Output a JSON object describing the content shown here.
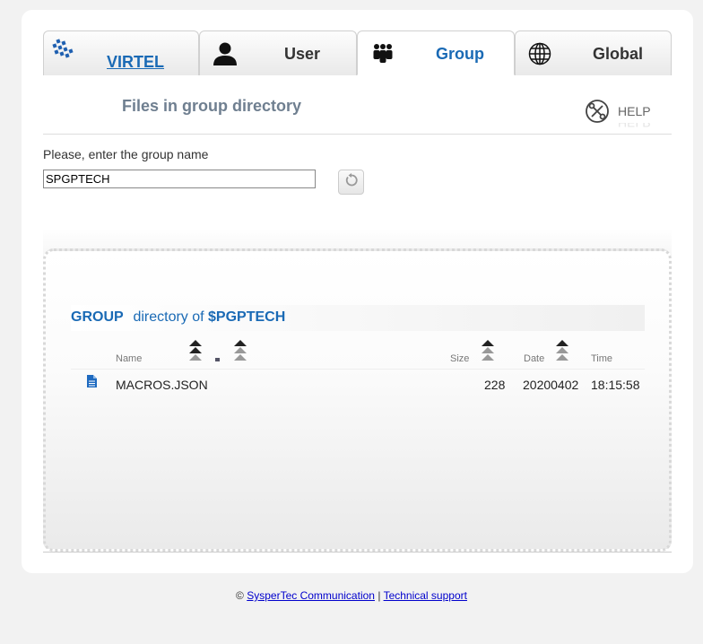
{
  "tabs": [
    {
      "label": "VIRTEL",
      "icon": "virtel-logo-icon"
    },
    {
      "label": "User",
      "icon": "user-icon"
    },
    {
      "label": "Group",
      "icon": "group-icon",
      "active": true
    },
    {
      "label": "Global",
      "icon": "globe-icon"
    }
  ],
  "page": {
    "title": "Files in group directory",
    "help_label": "HELP",
    "prompt": "Please, enter the group name",
    "group_value": "SPGPTECH"
  },
  "directory": {
    "prefix": "GROUP",
    "middle": " directory of ",
    "name": "$PGPTECH",
    "columns": {
      "name": "Name",
      "size": "Size",
      "date": "Date",
      "time": "Time"
    },
    "rows": [
      {
        "name": "MACROS.JSON",
        "size": "228",
        "date": "20200402",
        "time": "18:15:58",
        "icon": "file-icon"
      }
    ]
  },
  "footer": {
    "copyright": "©",
    "company": "SysperTec Communication",
    "separator": "|",
    "support": "Technical support"
  },
  "colors": {
    "accent": "#1a6ab5",
    "title": "#6f7f90"
  }
}
